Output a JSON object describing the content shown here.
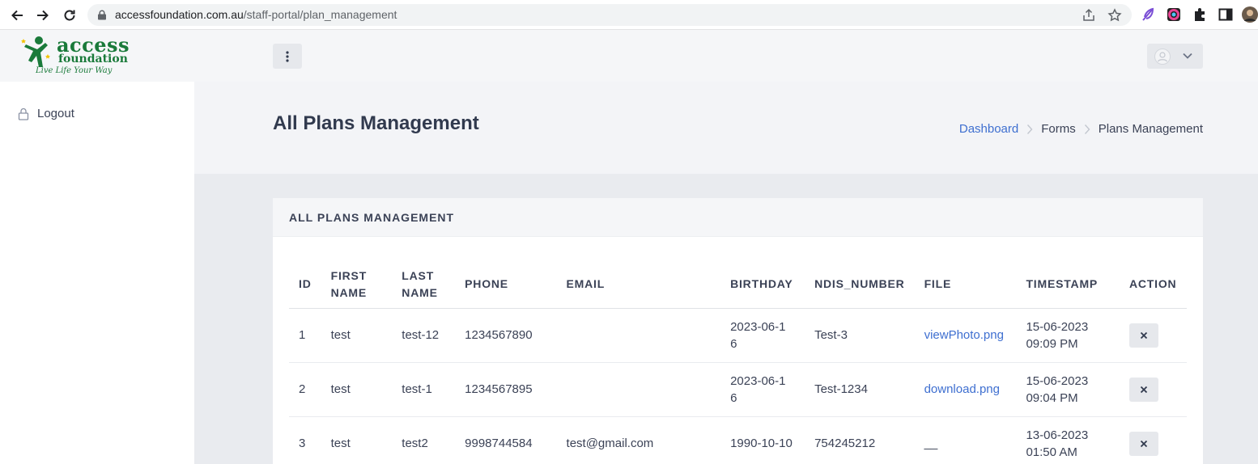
{
  "browser": {
    "url_host": "accessfoundation.com.au",
    "url_path": "/staff-portal/plan_management"
  },
  "sidebar": {
    "logo_line1": "access",
    "logo_line2": "foundation",
    "logo_tagline": "Live Life Your Way",
    "logout_label": "Logout"
  },
  "header": {
    "page_title": "All Plans Management",
    "breadcrumb": [
      "Dashboard",
      "Forms",
      "Plans Management"
    ]
  },
  "card": {
    "title": "ALL PLANS MANAGEMENT",
    "columns": [
      "ID",
      "FIRST NAME",
      "LAST NAME",
      "PHONE",
      "EMAIL",
      "BIRTHDAY",
      "NDIS_NUMBER",
      "FILE",
      "TIMESTAMP",
      "ACTION"
    ],
    "rows": [
      {
        "id": "1",
        "first": "test",
        "last": "test-12",
        "phone": "1234567890",
        "email": "",
        "birthday": "2023-06-16",
        "ndis": "Test-3",
        "file": "viewPhoto.png",
        "timestamp": "15-06-2023 09:09 PM"
      },
      {
        "id": "2",
        "first": "test",
        "last": "test-1",
        "phone": "1234567895",
        "email": "",
        "birthday": "2023-06-16",
        "ndis": "Test-1234",
        "file": "download.png",
        "timestamp": "15-06-2023 09:04 PM"
      },
      {
        "id": "3",
        "first": "test",
        "last": "test2",
        "phone": "9998744584",
        "email": "test@gmail.com",
        "birthday": "1990-10-10",
        "ndis": "754245212",
        "file": "__",
        "timestamp": "13-06-2023 01:50 AM"
      }
    ]
  },
  "colors": {
    "accent_link": "#3e6fd0",
    "brand_green": "#1a7a3a",
    "text_dark": "#3b4256"
  }
}
